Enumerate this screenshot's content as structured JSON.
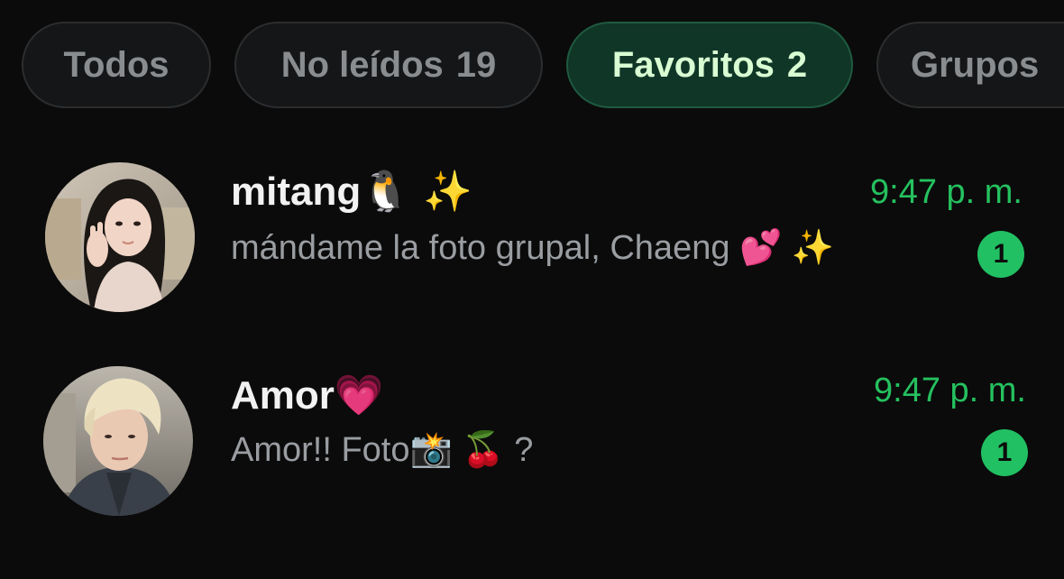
{
  "filters": [
    {
      "label": "Todos",
      "count": ""
    },
    {
      "label": "No leídos",
      "count": "19"
    },
    {
      "label": "Favoritos",
      "count": "2"
    },
    {
      "label": "Grupos",
      "count": ""
    }
  ],
  "active_filter": "Favoritos",
  "chats": [
    {
      "name": "mitang",
      "name_emoji": "🐧 ✨",
      "time": "9:47 p. m.",
      "preview": "mándame la foto grupal, Chaeng 💕 ✨",
      "unread": "1",
      "avatar_icon": "woman-portrait"
    },
    {
      "name": "Amor",
      "name_emoji": "💗",
      "time": "9:47 p. m.",
      "preview": "Amor!! Foto📸 🍒 ?",
      "unread": "1",
      "avatar_icon": "blond-person-portrait"
    }
  ],
  "colors": {
    "background": "#0b0b0b",
    "accent_green": "#25c15f",
    "active_chip_bg": "#103627",
    "active_chip_text": "#d9fdd3",
    "badge": "#21c063"
  }
}
